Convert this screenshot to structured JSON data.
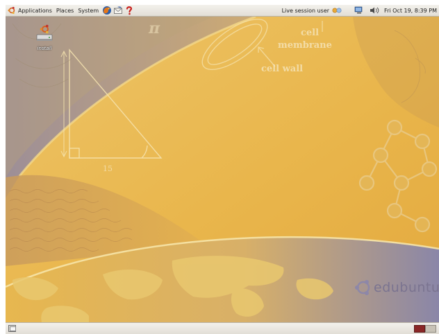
{
  "top_panel": {
    "menus": [
      {
        "label": "Applications",
        "icon": "ubuntu-logo-icon"
      },
      {
        "label": "Places"
      },
      {
        "label": "System"
      }
    ],
    "launchers": [
      "firefox-icon",
      "mail-icon",
      "help-icon"
    ],
    "user_label": "Live session user",
    "tray_icons": [
      "user-switch-icon",
      "network-icon",
      "volume-icon"
    ],
    "clock": "Fri Oct 19,  8:39 PM"
  },
  "desktop": {
    "icons": [
      {
        "label": "install",
        "icon": "installer-icon"
      }
    ],
    "wallpaper_text": {
      "cell": "cell",
      "membrane": "membrane",
      "cell_wall": "cell wall",
      "pi": "π",
      "fifteen": "15",
      "brand": "edubuntu"
    }
  },
  "bottom_panel": {
    "show_desktop": "show-desktop-icon",
    "workspaces": [
      {
        "name": "workspace-1",
        "active": true
      },
      {
        "name": "workspace-2",
        "active": false
      }
    ]
  },
  "colors": {
    "wallpaper": "#e8b84e",
    "panel": "#e9e6df",
    "workspace_active": "#8a2626",
    "brand_text": "#7b7490"
  }
}
